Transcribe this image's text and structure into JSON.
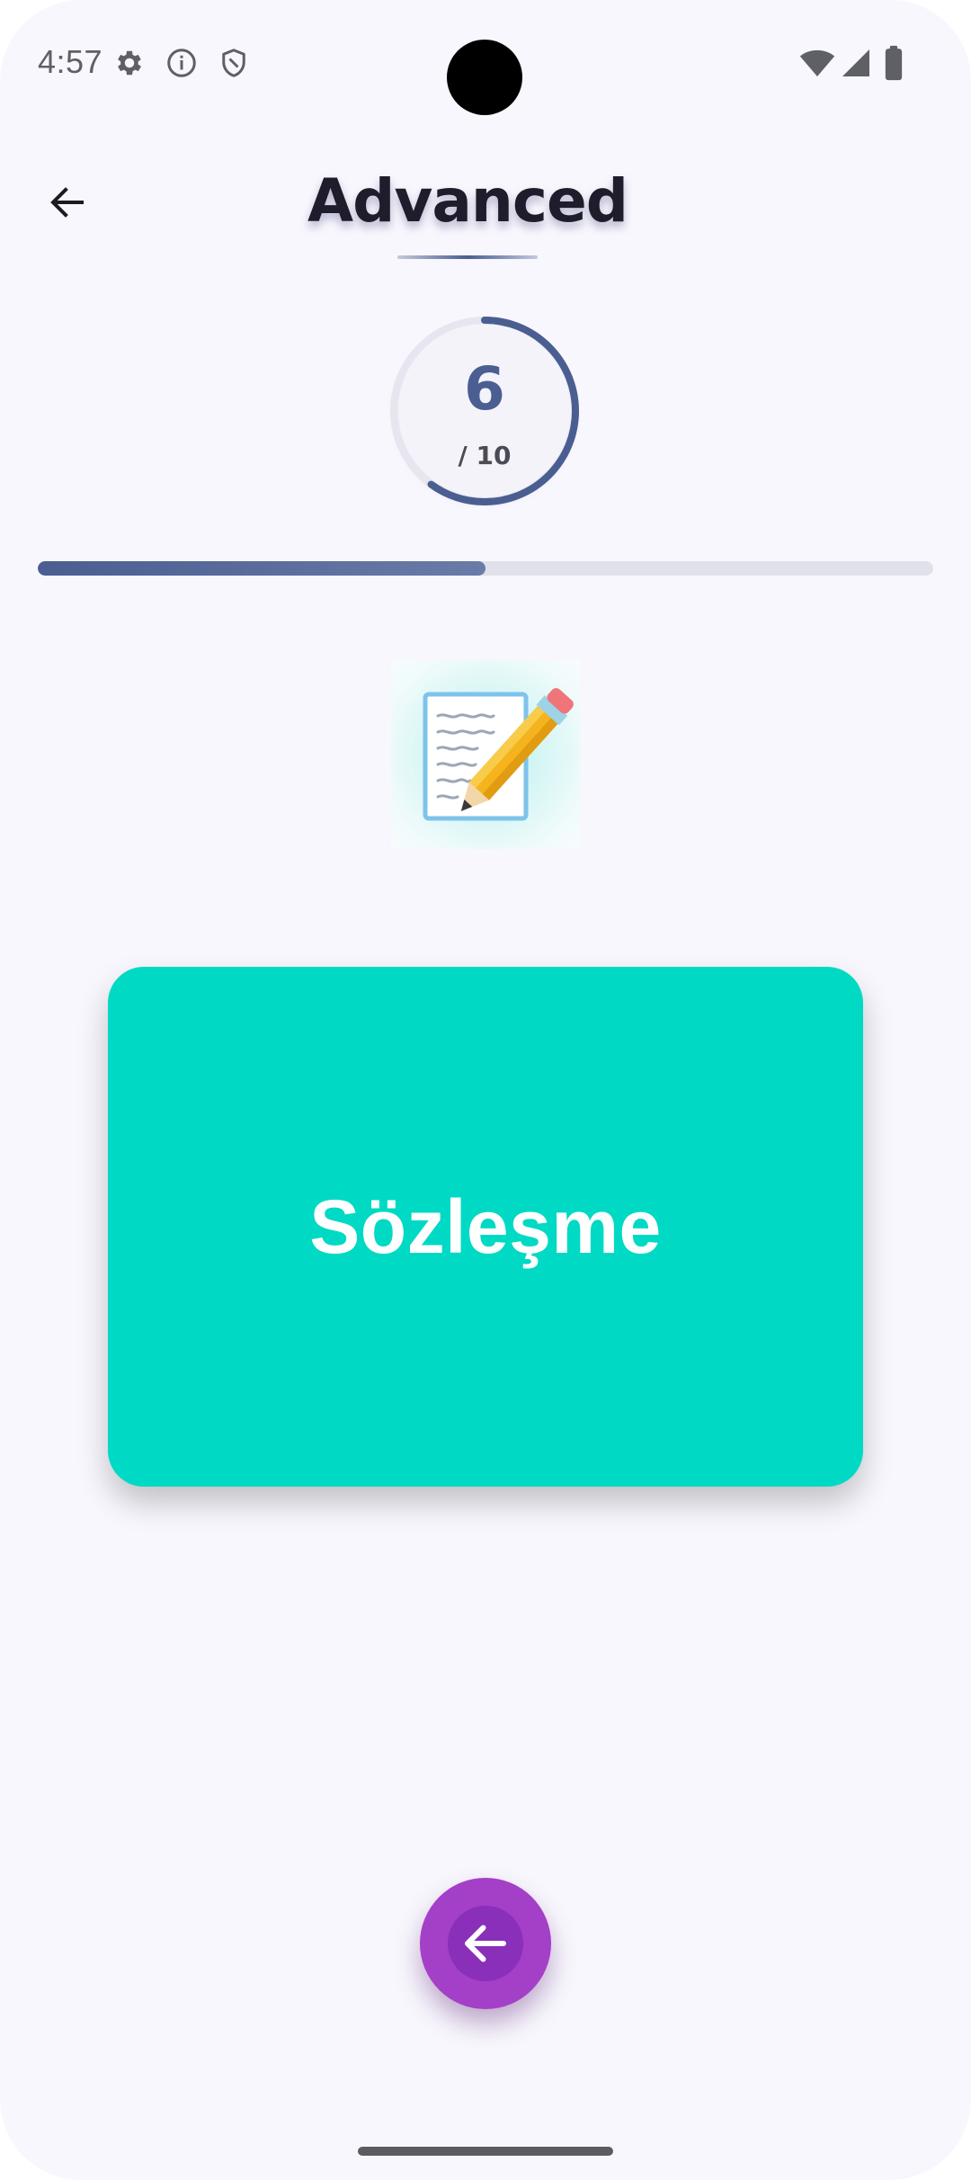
{
  "status_bar": {
    "time": "4:57",
    "left_icons": [
      "gear-icon",
      "info-icon",
      "shield-icon"
    ],
    "right_icons": [
      "wifi-icon",
      "cellular-signal-icon",
      "battery-icon"
    ]
  },
  "header": {
    "title": "Advanced",
    "back_icon": "arrow-left-icon"
  },
  "progress": {
    "current": "6",
    "total": "/ 10",
    "fraction": 0.6,
    "linear_fraction": 0.5,
    "color": "#4a5e91"
  },
  "illustration": {
    "icon": "memo-pencil-icon"
  },
  "card": {
    "word": "Sözleşme",
    "color": "#00d9c4"
  },
  "fab": {
    "icon": "arrow-left-icon",
    "color": "#a43fc8"
  }
}
